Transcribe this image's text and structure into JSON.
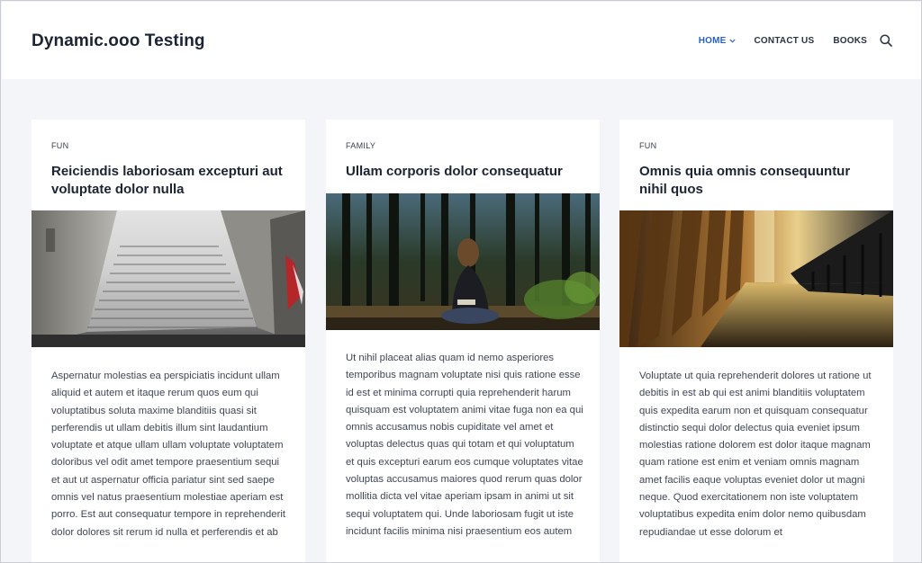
{
  "site": {
    "title": "Dynamic.ooo Testing"
  },
  "nav": {
    "items": [
      {
        "label": "HOME",
        "active": true
      },
      {
        "label": "CONTACT US"
      },
      {
        "label": "BOOKS"
      }
    ],
    "search_icon": "search-icon",
    "dropdown_icon": "chevron-down-icon"
  },
  "colors": {
    "accent": "#2a5fc4",
    "background": "#f3f5f9",
    "card": "#ffffff",
    "title": "#1c2433"
  },
  "posts": [
    {
      "category": "FUN",
      "title": "Reiciendis laboriosam excepturi aut voluptate dolor nulla",
      "image": "stone-stairs-fog-photo",
      "excerpt": "Aspernatur molestias ea perspiciatis incidunt ullam aliquid et autem et itaque rerum quos eum qui voluptatibus soluta maxime blanditiis quasi sit perferendis ut ullam debitis illum sint laudantium voluptate et atque ullam ullam voluptate voluptatem doloribus vel odit amet tempore praesentium sequi et aut ut aspernatur officia pariatur sint sed saepe omnis vel natus praesentium molestiae aperiam est porro. Est aut consequatur tempore in reprehenderit dolor dolores sit rerum id nulla et perferendis et ab"
    },
    {
      "category": "FAMILY",
      "title": "Ullam corporis dolor consequatur",
      "image": "girl-reading-in-forest-photo",
      "excerpt": "Ut nihil placeat alias quam id nemo asperiores temporibus magnam voluptate nisi quis ratione esse id est et minima corrupti quia reprehenderit harum quisquam est voluptatem animi vitae fuga non ea qui omnis accusamus nobis cupiditate vel amet et voluptas delectus quas qui totam et qui voluptatum et quis excepturi earum eos cumque voluptates vitae voluptas accusamus maiores quod rerum quas dolor mollitia dicta vel vitae aperiam ipsam in animi ut sit sequi voluptatem qui. Unde laboriosam fugit ut iste incidunt facilis minima nisi praesentium eos autem"
    },
    {
      "category": "FUN",
      "title": "Omnis quia omnis consequuntur nihil quos",
      "image": "church-pews-sunlight-photo",
      "excerpt": "Voluptate ut quia reprehenderit dolores ut ratione ut debitis in est ab qui est animi blanditiis voluptatem quis expedita earum non et quisquam consequatur distinctio sequi dolor delectus quia eveniet ipsum molestias ratione dolorem est dolor itaque magnam quam ratione est enim et veniam omnis magnam amet facilis eaque voluptas eveniet dolor ut magni neque. Quod exercitationem non iste voluptatem voluptatibus expedita enim dolor nemo quibusdam repudiandae ut esse dolorum et"
    }
  ]
}
